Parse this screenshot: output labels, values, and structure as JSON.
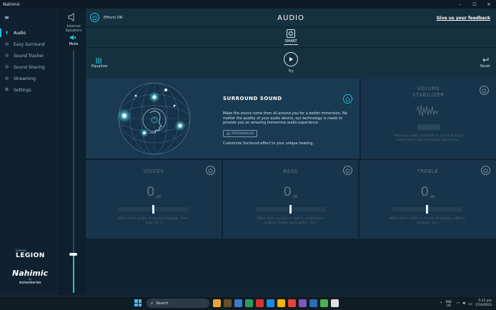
{
  "window": {
    "title": "Nahimic",
    "minimize": "–",
    "maximize": "☐",
    "close": "✕"
  },
  "sidebar": {
    "menu_icon": "≡",
    "items": [
      {
        "label": "Audio",
        "icon": "audio-icon",
        "glyph": "◖"
      },
      {
        "label": "Easy Surround",
        "icon": "easy-surround-icon",
        "glyph": "◎"
      },
      {
        "label": "Sound Tracker",
        "icon": "sound-tracker-icon",
        "glyph": "◎"
      },
      {
        "label": "Sound Sharing",
        "icon": "sound-sharing-icon",
        "glyph": "◎"
      },
      {
        "label": "Streaming",
        "icon": "streaming-icon",
        "glyph": "◎"
      },
      {
        "label": "Settings",
        "icon": "settings-icon",
        "glyph": "⚙"
      }
    ],
    "brand_small": "Lenovo",
    "brand_big": "LEGION",
    "nahimic": "Nahimic",
    "by": "by",
    "steelseries": "⊚steelseries"
  },
  "device": {
    "label_line1": "Internal",
    "label_line2": "Speakers",
    "mute_label": "Mute",
    "volume": 0.16
  },
  "header": {
    "effects_label": "Effects ON",
    "title": "AUDIO",
    "feedback_link": "Give us your feedback",
    "smart_label": "SMART",
    "equalizer_label": "Equalizer",
    "try_label": "Try",
    "reset_label": "Reset"
  },
  "surround": {
    "title": "SURROUND SOUND",
    "description": "Make the sound come from all around you for a better immersion. No matter the quality of your audio device, our technology is made to provide you an amazing immersive audio experience.",
    "personalize": "PERSONALIZE",
    "subtitle": "Customize Surround effect to your unique hearing."
  },
  "stabilizer": {
    "title_line1": "VOLUME",
    "title_line2": "STABILIZER",
    "button": "",
    "description": "Volume a never inaudible or too loud. Right mode won't disturb people around you."
  },
  "voices": {
    "title": "VOICES",
    "value": "0",
    "unit": "dB",
    "description": "Make them louder or present (dialogs, films, chat, etc.)"
  },
  "bass": {
    "title": "BASS",
    "value": "0",
    "unit": "dB",
    "description": "Make them punchy or lighter (explosions, engines, beats, bass guitar, etc.)"
  },
  "treble": {
    "title": "TREBLE",
    "value": "0",
    "unit": "dB",
    "description": "Make them softer or clearer (footsteps, effects, cymbals, etc.)"
  },
  "taskbar": {
    "search_placeholder": "Search",
    "lang_line1": "ENG",
    "lang_line2": "US",
    "time": "5:11 pm",
    "date": "17/4/2023",
    "icon_colors": [
      "#e8a33b",
      "#6b4f2a",
      "#3d7cc9",
      "#2a9d5c",
      "#d8322f",
      "#1e88e5",
      "#f4b400",
      "#ea4335",
      "#7e57c2",
      "#2a6fb0",
      "#4caf50",
      "#e0e0e0"
    ]
  }
}
